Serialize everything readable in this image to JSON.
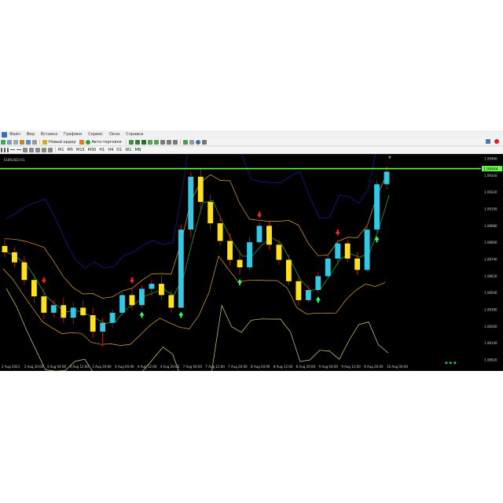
{
  "menu": [
    "Файл",
    "Вид",
    "Вставка",
    "Графики",
    "Сервис",
    "Окна",
    "Справка"
  ],
  "toolbar": {
    "new_order": "Новый ордер",
    "auto_trading": "Авто-торговля",
    "timeframes": [
      "M1",
      "M5",
      "M15",
      "M30",
      "H1",
      "H4",
      "D1",
      "W1",
      "MN"
    ]
  },
  "chart": {
    "symbol": "EURUSD,H1",
    "level_label": "1.09444",
    "price_labels": [
      "1.09460",
      "1.09340",
      "1.09220",
      "1.09100",
      "1.08980",
      "1.08860",
      "1.08740",
      "1.08620",
      "1.08500",
      "1.08380",
      "1.08260",
      "1.08140",
      "1.08020"
    ],
    "date_labels": [
      "2 Aug 2023",
      "2 Aug 20:00",
      "3 Aug 04:00",
      "3 Aug 12:00",
      "3 Aug 20:00",
      "4 Aug 04:00",
      "4 Aug 12:00",
      "4 Aug 20:00",
      "7 Aug 04:00",
      "7 Aug 12:00",
      "7 Aug 20:00",
      "8 Aug 04:00",
      "8 Aug 12:00",
      "8 Aug 20:00",
      "9 Aug 04:00",
      "9 Aug 12:00",
      "9 Aug 20:00",
      "10 Aug 04:00"
    ],
    "colors": {
      "background": "#000000",
      "bull": "#33c9e6",
      "bear": "#ffe21f",
      "level": "#66ff44",
      "band_outer": "#1a1a8c",
      "band_middle": "#e6a23c",
      "band_lower": "#d8d27a",
      "ma": "#2aa02a",
      "arrow_up": "#33ff66",
      "arrow_down": "#ff2222"
    }
  },
  "chart_data": {
    "type": "candlestick",
    "ylim": [
      1.079,
      1.0951
    ],
    "level": 1.09444,
    "candles": [
      [
        1.0883,
        1.0889,
        1.0874,
        1.0878
      ],
      [
        1.0878,
        1.0882,
        1.0866,
        1.087
      ],
      [
        1.087,
        1.0875,
        1.0852,
        1.0856
      ],
      [
        1.0856,
        1.0861,
        1.0838,
        1.0843
      ],
      [
        1.0843,
        1.085,
        1.0825,
        1.083
      ],
      [
        1.083,
        1.084,
        1.0826,
        1.0836
      ],
      [
        1.0836,
        1.0842,
        1.0822,
        1.0826
      ],
      [
        1.0826,
        1.0838,
        1.0821,
        1.0834
      ],
      [
        1.0834,
        1.084,
        1.0826,
        1.0828
      ],
      [
        1.0828,
        1.0834,
        1.081,
        1.0815
      ],
      [
        1.0815,
        1.0826,
        1.0803,
        1.0822
      ],
      [
        1.0822,
        1.0833,
        1.0818,
        1.083
      ],
      [
        1.083,
        1.0846,
        1.0828,
        1.0844
      ],
      [
        1.0844,
        1.085,
        1.0832,
        1.0836
      ],
      [
        1.0836,
        1.0852,
        1.0834,
        1.0849
      ],
      [
        1.0849,
        1.0856,
        1.0843,
        1.0853
      ],
      [
        1.0853,
        1.086,
        1.084,
        1.0844
      ],
      [
        1.0844,
        1.0848,
        1.083,
        1.0834
      ],
      [
        1.0834,
        1.09,
        1.0834,
        1.0896
      ],
      [
        1.0896,
        1.0942,
        1.089,
        1.0938
      ],
      [
        1.0938,
        1.0945,
        1.0912,
        1.0918
      ],
      [
        1.0918,
        1.0924,
        1.0896,
        1.0901
      ],
      [
        1.0901,
        1.0907,
        1.0883,
        1.0887
      ],
      [
        1.0887,
        1.0893,
        1.0868,
        1.0872
      ],
      [
        1.0872,
        1.088,
        1.086,
        1.0866
      ],
      [
        1.0866,
        1.089,
        1.0864,
        1.0886
      ],
      [
        1.0886,
        1.0902,
        1.0884,
        1.0899
      ],
      [
        1.0899,
        1.0903,
        1.088,
        1.0884
      ],
      [
        1.0884,
        1.0888,
        1.0868,
        1.0872
      ],
      [
        1.0872,
        1.0876,
        1.0852,
        1.0855
      ],
      [
        1.0855,
        1.086,
        1.0836,
        1.084
      ],
      [
        1.084,
        1.0852,
        1.0838,
        1.0848
      ],
      [
        1.0848,
        1.0862,
        1.0846,
        1.0859
      ],
      [
        1.0859,
        1.0876,
        1.0857,
        1.0873
      ],
      [
        1.0873,
        1.0888,
        1.087,
        1.0885
      ],
      [
        1.0885,
        1.0888,
        1.087,
        1.0873
      ],
      [
        1.0873,
        1.0878,
        1.086,
        1.0864
      ],
      [
        1.0864,
        1.09,
        1.0862,
        1.0896
      ],
      [
        1.0896,
        1.0935,
        1.0894,
        1.0932
      ],
      [
        1.0932,
        1.0946,
        1.0928,
        1.0942
      ]
    ],
    "markers": [
      {
        "i": 4,
        "type": "down"
      },
      {
        "i": 13,
        "type": "down"
      },
      {
        "i": 14,
        "type": "up"
      },
      {
        "i": 18,
        "type": "up"
      },
      {
        "i": 24,
        "type": "up"
      },
      {
        "i": 26,
        "type": "down"
      },
      {
        "i": 32,
        "type": "up"
      },
      {
        "i": 34,
        "type": "down"
      },
      {
        "i": 38,
        "type": "up"
      }
    ]
  }
}
